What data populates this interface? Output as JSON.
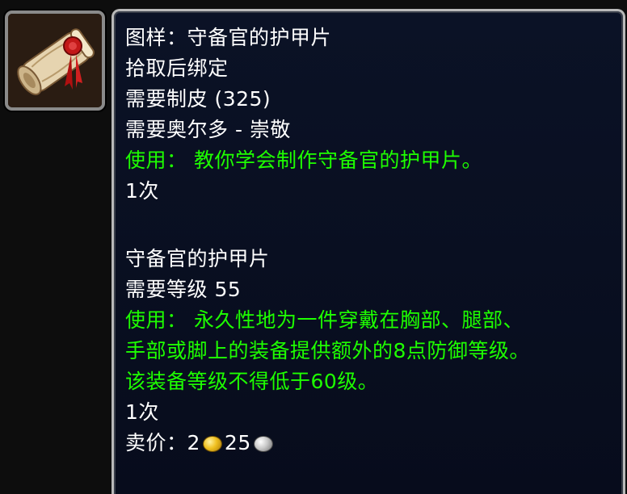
{
  "item_icon": {
    "name": "scroll-icon"
  },
  "tooltip": {
    "title": "图样：守备官的护甲片",
    "binding": "拾取后绑定",
    "requires_skill": "需要制皮 (325)",
    "requires_reputation": "需要奥尔多 - 崇敬",
    "use_text": "使用： 教你学会制作守备官的护甲片。",
    "charges": "1次",
    "created_item": {
      "name": "守备官的护甲片",
      "requires_level": "需要等级 55",
      "use_lines": [
        "使用： 永久性地为一件穿戴在胸部、腿部、",
        "手部或脚上的装备提供额外的8点防御等级。",
        "该装备等级不得低于60级。"
      ],
      "charges": "1次"
    },
    "sell_price": {
      "label": "卖价：",
      "gold": "2",
      "silver": "25"
    }
  },
  "colors": {
    "use_text": "#1eff00",
    "normal_text": "#ffffff",
    "tooltip_background": "#0b1226",
    "tooltip_border": "#b9b9b9"
  }
}
